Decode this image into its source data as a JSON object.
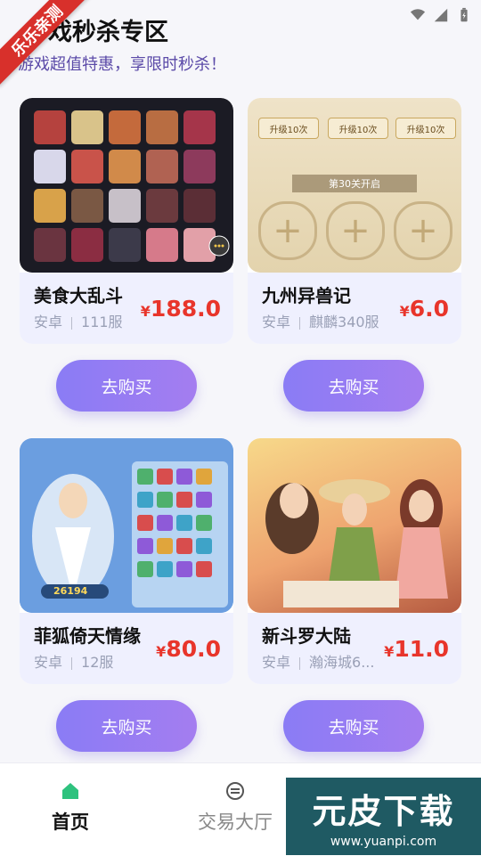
{
  "status_bar": {
    "icons": [
      "wifi-icon",
      "signal-icon",
      "battery-icon"
    ]
  },
  "ribbon": {
    "text": "乐乐亲测"
  },
  "header": {
    "title": "戏秒杀专区",
    "subtitle": "游戏超值特惠，享限时秒杀！"
  },
  "products": [
    {
      "name": "美食大乱斗",
      "platform": "安卓",
      "server": "111服",
      "currency": "¥",
      "price": "188.0",
      "button": "去购买"
    },
    {
      "name": "九州异兽记",
      "platform": "安卓",
      "server": "麒麟340服",
      "currency": "¥",
      "price": "6.0",
      "button": "去购买"
    },
    {
      "name": "菲狐倚天情缘",
      "platform": "安卓",
      "server": "12服",
      "currency": "¥",
      "price": "80.0",
      "button": "去购买"
    },
    {
      "name": "新斗罗大陆",
      "platform": "安卓",
      "server": "瀚海城6...",
      "currency": "¥",
      "price": "11.0",
      "button": "去购买"
    }
  ],
  "thumb_texts": {
    "p2_label": "第30关开启",
    "p2_btn1": "升级10次",
    "p2_btn2": "升级10次",
    "p2_btn3": "升级10次",
    "p3_power": "26194"
  },
  "bottom_nav": {
    "items": [
      {
        "label": "首页",
        "icon": "home-icon",
        "active": true
      },
      {
        "label": "交易大厅",
        "icon": "trade-icon",
        "active": false
      }
    ]
  },
  "watermark": {
    "big": "元皮下载",
    "small": "www.yuanpi.com"
  },
  "colors": {
    "accent": "#8a7cf5",
    "price": "#e8352b",
    "active_nav": "#2ec27e",
    "ribbon": "#d8302b"
  }
}
